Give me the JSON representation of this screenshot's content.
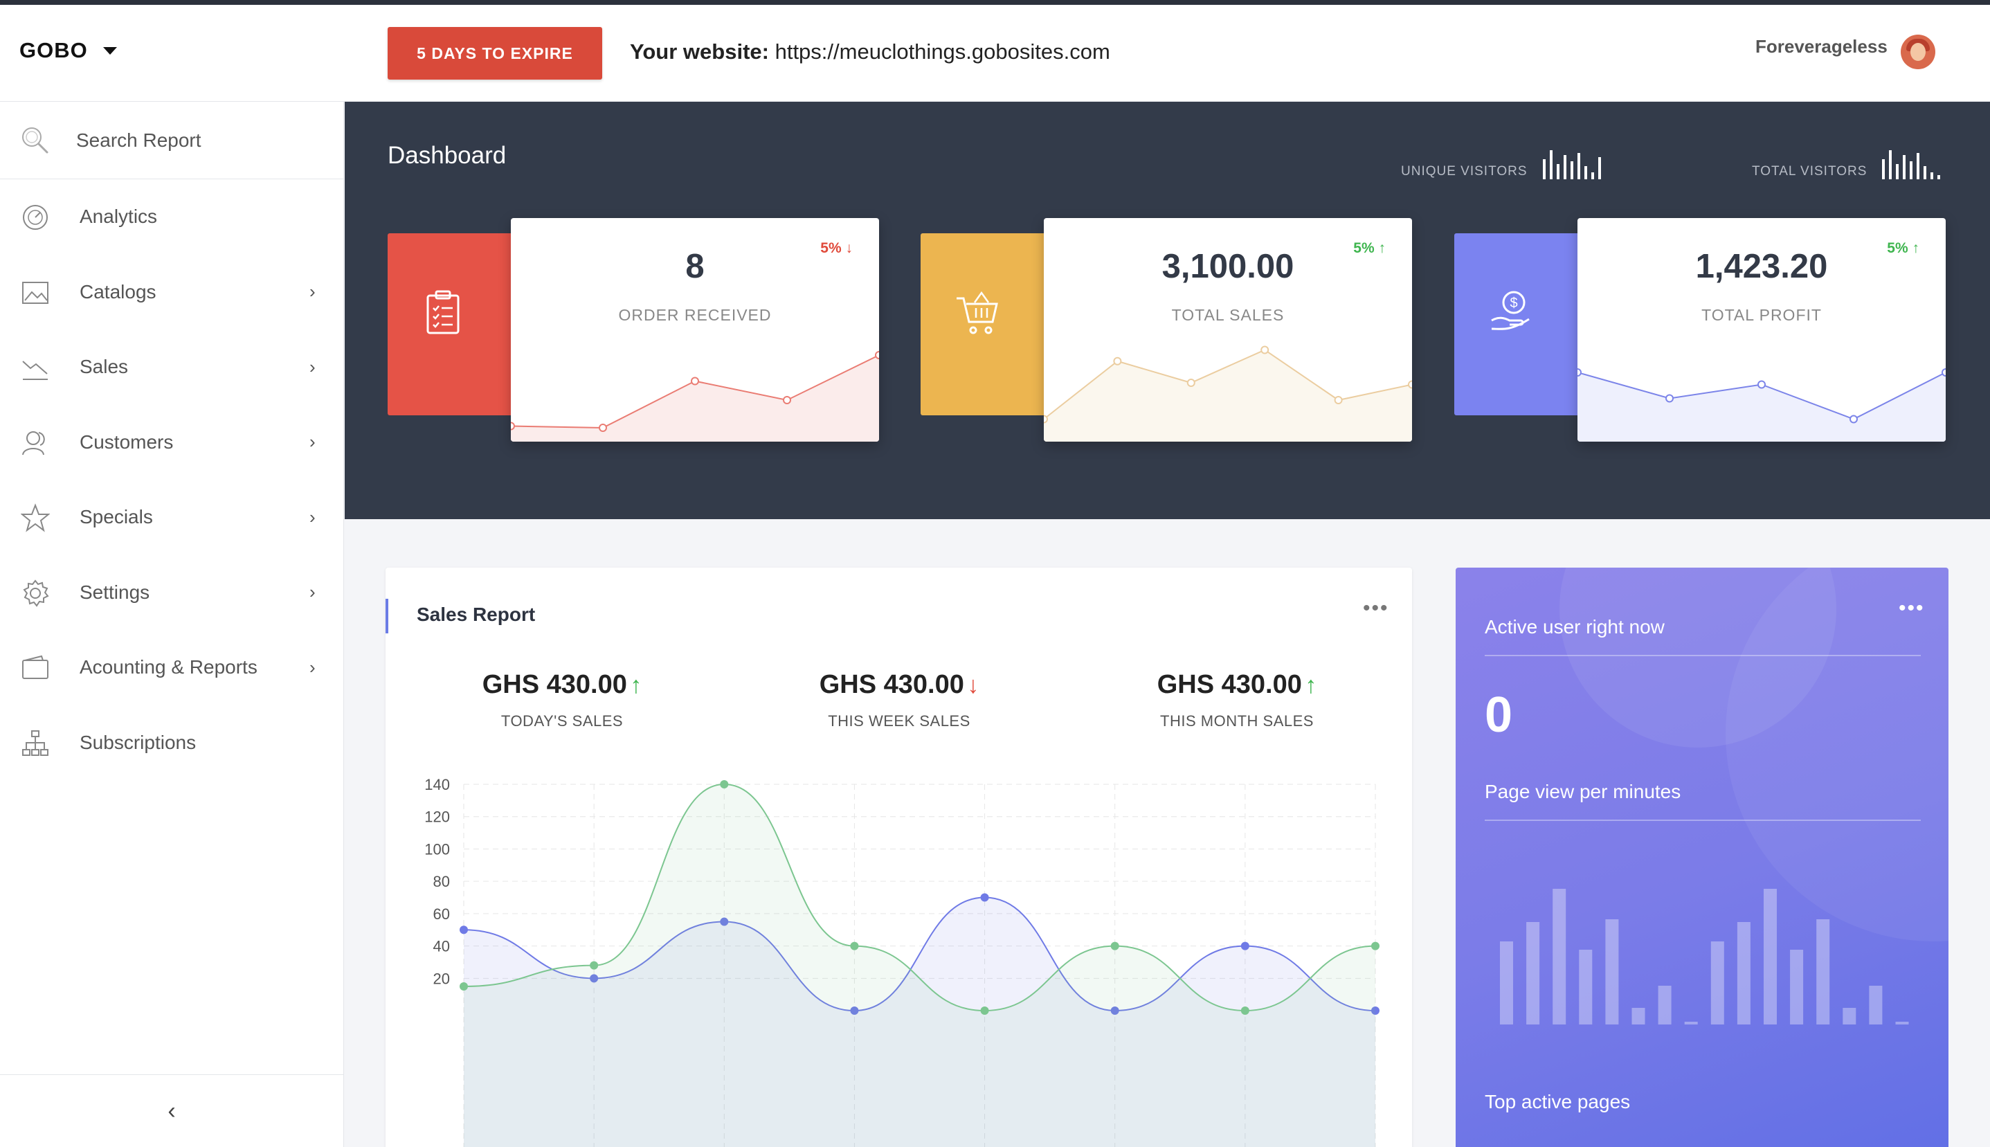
{
  "header": {
    "brand": "GOBO",
    "expire_label": "5 DAYS TO EXPIRE",
    "website_label": "Your website:",
    "website_url": "https://meuclothings.gobosites.com",
    "username": "Foreverageless"
  },
  "sidebar": {
    "search_placeholder": "Search Report",
    "items": [
      {
        "label": "Analytics",
        "icon": "analytics-icon",
        "has_submenu": false
      },
      {
        "label": "Catalogs",
        "icon": "image-icon",
        "has_submenu": true
      },
      {
        "label": "Sales",
        "icon": "trend-down-icon",
        "has_submenu": true
      },
      {
        "label": "Customers",
        "icon": "users-icon",
        "has_submenu": true
      },
      {
        "label": "Specials",
        "icon": "star-icon",
        "has_submenu": true
      },
      {
        "label": "Settings",
        "icon": "gear-icon",
        "has_submenu": true
      },
      {
        "label": "Acounting & Reports",
        "icon": "wallet-icon",
        "has_submenu": true
      },
      {
        "label": "Subscriptions",
        "icon": "sitemap-icon",
        "has_submenu": false
      }
    ],
    "chevron": "›",
    "collapse": "‹"
  },
  "dashboard": {
    "title": "Dashboard",
    "unique_visitors": "UNIQUE VISITORS",
    "total_visitors": "TOTAL VISITORS"
  },
  "stats": [
    {
      "value": "8",
      "label": "ORDER RECEIVED",
      "pct": "5%",
      "trend": "down",
      "tile_color": "#e55347",
      "line_color": "#ea7c73",
      "fill_color": "#fbeceb",
      "icon": "clipboard-icon",
      "spark": [
        10,
        8,
        62,
        40,
        92
      ]
    },
    {
      "value": "3,100.00",
      "label": "TOTAL SALES",
      "pct": "5%",
      "trend": "up",
      "tile_color": "#ecb550",
      "line_color": "#ebcda0",
      "fill_color": "#fbf7ee",
      "icon": "cart-icon",
      "spark": [
        18,
        85,
        60,
        98,
        40,
        58
      ]
    },
    {
      "value": "1,423.20",
      "label": "TOTAL PROFIT",
      "pct": "5%",
      "trend": "up",
      "tile_color": "#7b83f0",
      "line_color": "#7b84e9",
      "fill_color": "#eef0fd",
      "icon": "hand-coin-icon",
      "spark": [
        72,
        42,
        58,
        18,
        72
      ]
    }
  ],
  "sales_report": {
    "title": "Sales Report",
    "more": "•••",
    "kpis": [
      {
        "value": "GHS 430.00",
        "trend": "up",
        "label": "TODAY'S SALES"
      },
      {
        "value": "GHS 430.00",
        "trend": "down",
        "label": "THIS WEEK SALES"
      },
      {
        "value": "GHS 430.00",
        "trend": "up",
        "label": "THIS MONTH SALES"
      }
    ]
  },
  "chart_data": {
    "type": "area",
    "x": [
      0,
      1,
      2,
      3,
      4,
      5,
      6,
      7
    ],
    "ylim": [
      0,
      140
    ],
    "yticks": [
      20,
      40,
      60,
      80,
      100,
      120,
      140
    ],
    "grid": true,
    "series": [
      {
        "values": [
          50,
          20,
          55,
          0,
          70,
          0,
          40,
          0
        ],
        "color": "#6f7ae6"
      },
      {
        "values": [
          15,
          28,
          140,
          40,
          0,
          40,
          0,
          40
        ],
        "color": "#7cc690"
      }
    ]
  },
  "active_users": {
    "title": "Active user right now",
    "count": "0",
    "subtitle": "Page view per minutes",
    "footer": "Top active pages",
    "more": "•••",
    "bars": [
      30,
      37,
      49,
      27,
      38,
      6,
      14,
      1,
      30,
      37,
      49,
      27,
      38,
      6,
      14,
      1
    ]
  },
  "visitor_bars": {
    "unique": [
      18,
      26,
      14,
      22,
      16,
      24,
      12,
      6,
      20
    ],
    "total": [
      18,
      26,
      14,
      22,
      16,
      24,
      12,
      6,
      4
    ]
  }
}
